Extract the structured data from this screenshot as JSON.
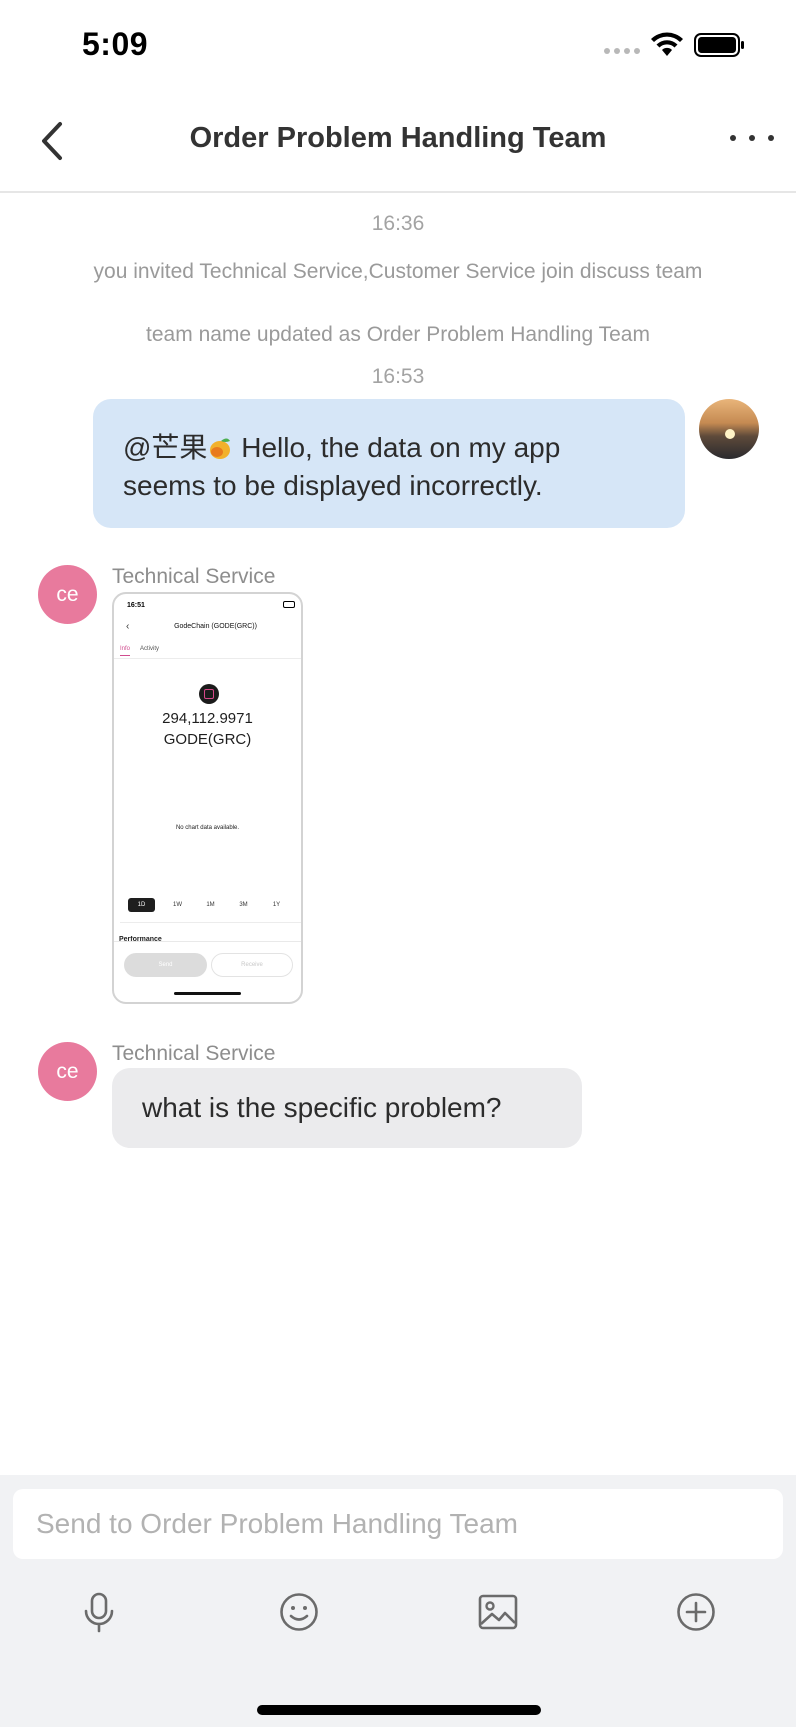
{
  "status_bar": {
    "time": "5:09",
    "icons": [
      "signal-dots-icon",
      "wifi-icon",
      "battery-icon"
    ]
  },
  "nav": {
    "title": "Order Problem Handling Team",
    "back_icon": "chevron-left-icon",
    "more_icon": "more-dots-icon"
  },
  "messages": {
    "time_1": "16:36",
    "system_1": "you invited Technical Service,Customer Service join discuss team",
    "system_2": "team name updated as Order Problem Handling Team",
    "time_2": "16:53",
    "mine": {
      "mention": "@芒果",
      "mention_emoji": "mango-emoji",
      "text_line_1": " Hello, the data on my app",
      "text_line_2": "seems to be displayed incorrectly."
    },
    "incoming_image": {
      "sender": "Technical Service",
      "avatar_text": "ce",
      "screenshot": {
        "time": "16:51",
        "title": "GodeChain (GODE(GRC))",
        "tabs": [
          "Info",
          "Activity"
        ],
        "amount": "294,112.9971",
        "unit": "GODE(GRC)",
        "empty_chart": "No chart data available.",
        "ranges": [
          "1D",
          "1W",
          "1M",
          "3M",
          "1Y"
        ],
        "section": "Performance",
        "send": "Send",
        "receive": "Receive"
      }
    },
    "incoming_text": {
      "sender": "Technical Service",
      "avatar_text": "ce",
      "text": "what is the specific problem?"
    }
  },
  "composer": {
    "placeholder": "Send to Order Problem Handling Team",
    "tools": [
      "microphone-icon",
      "smiley-icon",
      "image-icon",
      "plus-circle-icon"
    ]
  },
  "colors": {
    "my_bubble": "#d6e6f7",
    "their_bubble": "#ebebed",
    "avatar_pink": "#e87a9d",
    "composer_bg": "#f1f2f4"
  }
}
